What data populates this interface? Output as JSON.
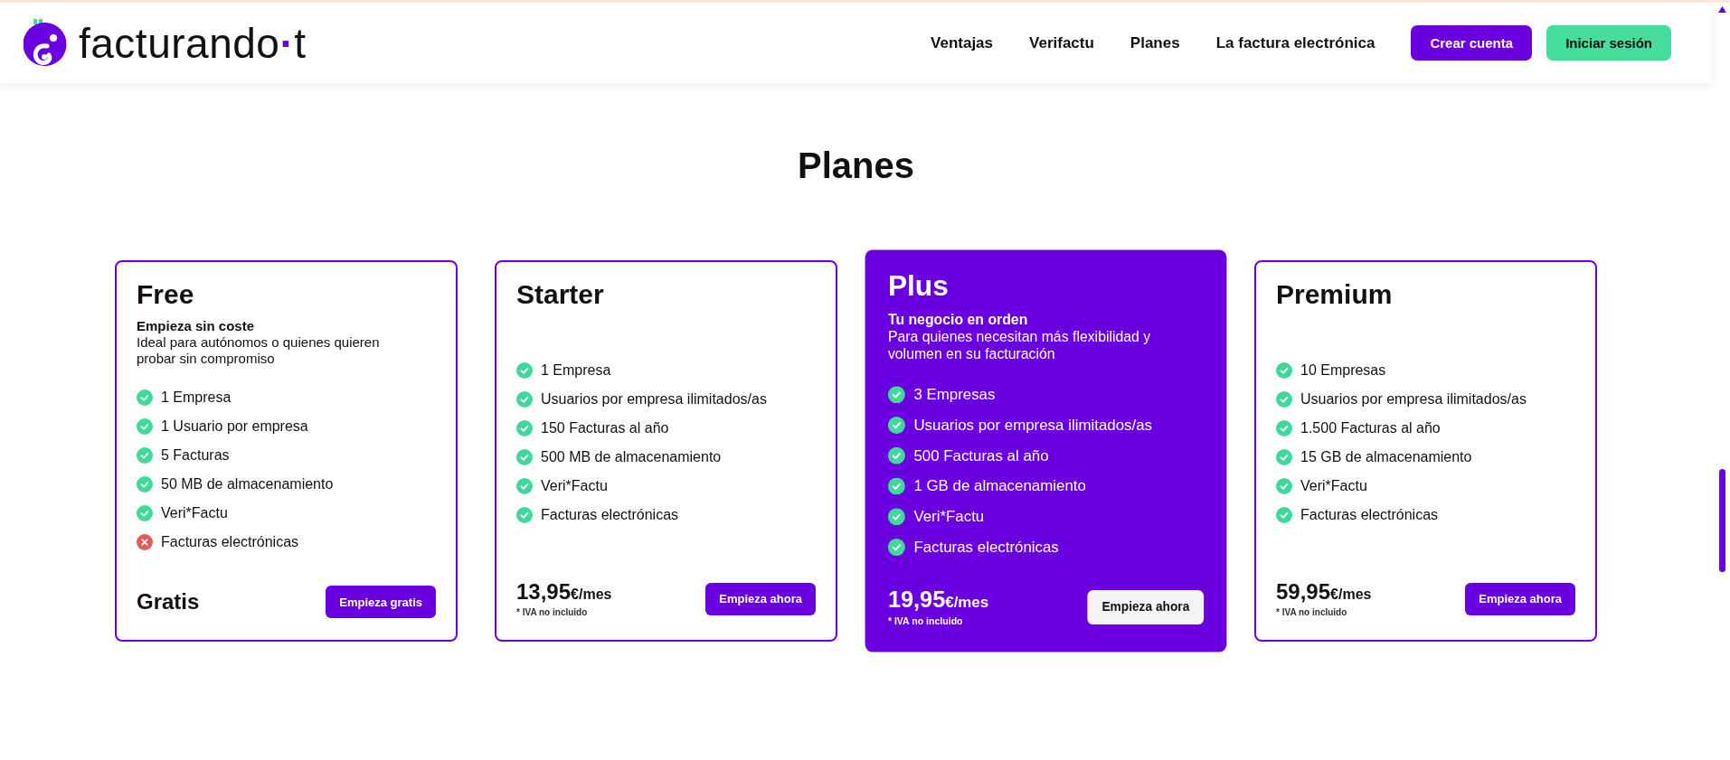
{
  "header": {
    "logo": {
      "word": "facturando",
      "separator": "·",
      "suffix": "t"
    },
    "nav": [
      {
        "label": "Ventajas"
      },
      {
        "label": "Verifactu"
      },
      {
        "label": "Planes"
      },
      {
        "label": "La factura electrónica"
      }
    ],
    "buttons": [
      {
        "label": "Crear cuenta",
        "kind": "primary"
      },
      {
        "label": "Iniciar sesión",
        "kind": "secondary"
      }
    ]
  },
  "title": "Planes",
  "plans": [
    {
      "name": "Free",
      "highlighted": false,
      "tagline": "Empieza sin coste",
      "description": "Ideal para autónomos o quienes quieren probar sin compromiso",
      "features": [
        {
          "label": "1 Empresa",
          "included": true
        },
        {
          "label": "1 Usuario por empresa",
          "included": true
        },
        {
          "label": "5 Facturas",
          "included": true
        },
        {
          "label": "50 MB de almacenamiento",
          "included": true
        },
        {
          "label": "Veri*Factu",
          "included": true
        },
        {
          "label": "Facturas electrónicas",
          "included": false
        }
      ],
      "price": "Gratis",
      "button": "Empieza gratis"
    },
    {
      "name": "Starter",
      "highlighted": false,
      "features": [
        {
          "label": "1 Empresa",
          "included": true
        },
        {
          "label": "Usuarios por empresa ilimitados/as",
          "included": true
        },
        {
          "label": "150 Facturas al año",
          "included": true
        },
        {
          "label": "500 MB de almacenamiento",
          "included": true
        },
        {
          "label": "Veri*Factu",
          "included": true
        },
        {
          "label": "Facturas electrónicas",
          "included": true
        }
      ],
      "price": "13,95",
      "period": "€/mes",
      "note": "* IVA no incluido",
      "button": "Empieza ahora"
    },
    {
      "name": "Plus",
      "highlighted": true,
      "tagline": "Tu negocio en orden",
      "description": "Para quienes necesitan más flexibilidad y volumen en su facturación",
      "features": [
        {
          "label": "3 Empresas",
          "included": true
        },
        {
          "label": "Usuarios por empresa ilimitados/as",
          "included": true
        },
        {
          "label": "500 Facturas al año",
          "included": true
        },
        {
          "label": "1 GB de almacenamiento",
          "included": true
        },
        {
          "label": "Veri*Factu",
          "included": true
        },
        {
          "label": "Facturas electrónicas",
          "included": true
        }
      ],
      "price": "19,95",
      "period": "€/mes",
      "note": "* IVA no incluido",
      "button": "Empieza ahora"
    },
    {
      "name": "Premium",
      "highlighted": false,
      "features": [
        {
          "label": "10 Empresas",
          "included": true
        },
        {
          "label": "Usuarios por empresa ilimitados/as",
          "included": true
        },
        {
          "label": "1.500 Facturas al año",
          "included": true
        },
        {
          "label": "15 GB de almacenamiento",
          "included": true
        },
        {
          "label": "Veri*Factu",
          "included": true
        },
        {
          "label": "Facturas electrónicas",
          "included": true
        }
      ],
      "price": "59,95",
      "period": "€/mes",
      "note": "* IVA no incluido",
      "button": "Empieza ahora"
    }
  ]
}
